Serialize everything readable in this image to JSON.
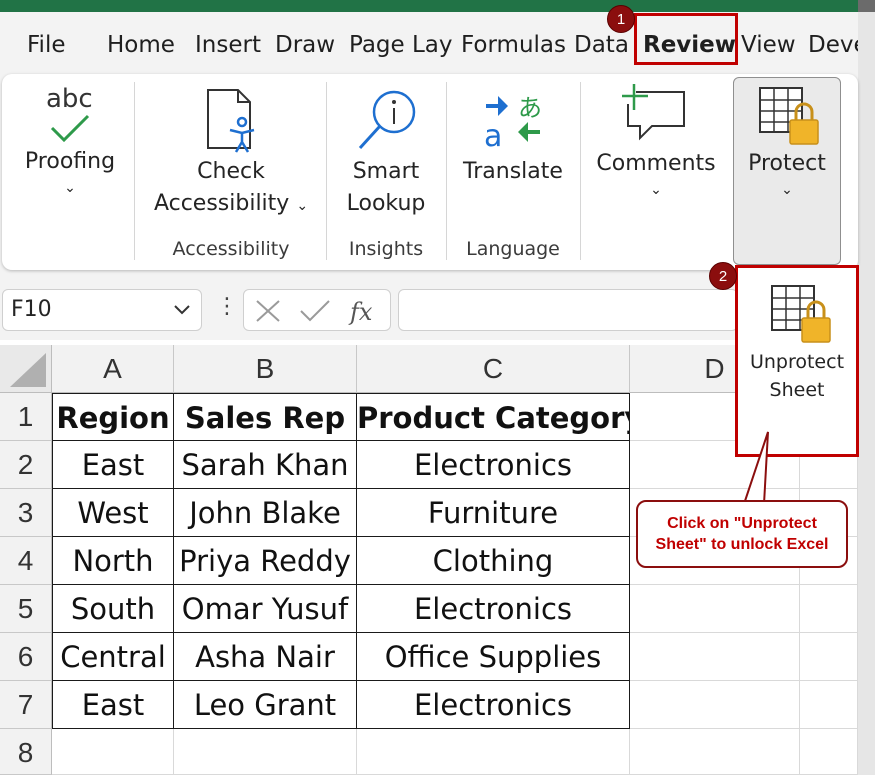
{
  "tabs": [
    {
      "label": "File"
    },
    {
      "label": "Home"
    },
    {
      "label": "Insert"
    },
    {
      "label": "Draw"
    },
    {
      "label": "Page Layout"
    },
    {
      "label": "Formulas"
    },
    {
      "label": "Data"
    },
    {
      "label": "Review"
    },
    {
      "label": "View"
    },
    {
      "label": "Developer"
    }
  ],
  "steps": [
    "1",
    "2"
  ],
  "ribbon": {
    "proofing": {
      "icon_text": "abc",
      "label": "Proofing",
      "chevron": "⌄"
    },
    "check_accessibility": {
      "label1": "Check",
      "label2": "Accessibility",
      "chevron": "⌄"
    },
    "smart_lookup": {
      "label1": "Smart",
      "label2": "Lookup"
    },
    "translate": {
      "label": "Translate"
    },
    "comments": {
      "label": "Comments",
      "chevron": "⌄"
    },
    "protect": {
      "label": "Protect",
      "chevron": "⌄"
    },
    "groups": {
      "accessibility": "Accessibility",
      "insights": "Insights",
      "language": "Language"
    }
  },
  "formula_bar": {
    "name_box": "F10",
    "formula": ""
  },
  "columns": [
    "A",
    "B",
    "C",
    "D"
  ],
  "rows": [
    "1",
    "2",
    "3",
    "4",
    "5",
    "6",
    "7",
    "8"
  ],
  "table": {
    "headers": [
      "Region",
      "Sales Rep",
      "Product Category"
    ],
    "rows": [
      [
        "East",
        "Sarah Khan",
        "Electronics"
      ],
      [
        "West",
        "John Blake",
        "Furniture"
      ],
      [
        "North",
        "Priya Reddy",
        "Clothing"
      ],
      [
        "South",
        "Omar Yusuf",
        "Electronics"
      ],
      [
        "Central",
        "Asha Nair",
        "Office Supplies"
      ],
      [
        "East",
        "Leo Grant",
        "Electronics"
      ]
    ]
  },
  "dropdown": {
    "line1": "Unprotect",
    "line2": "Sheet"
  },
  "callout": {
    "line1": "Click on \"Unprotect",
    "line2": "Sheet\" to unlock Excel"
  },
  "colors": {
    "accent": "#217346",
    "highlight": "#c00000",
    "step_badge": "#8b0e0e"
  }
}
